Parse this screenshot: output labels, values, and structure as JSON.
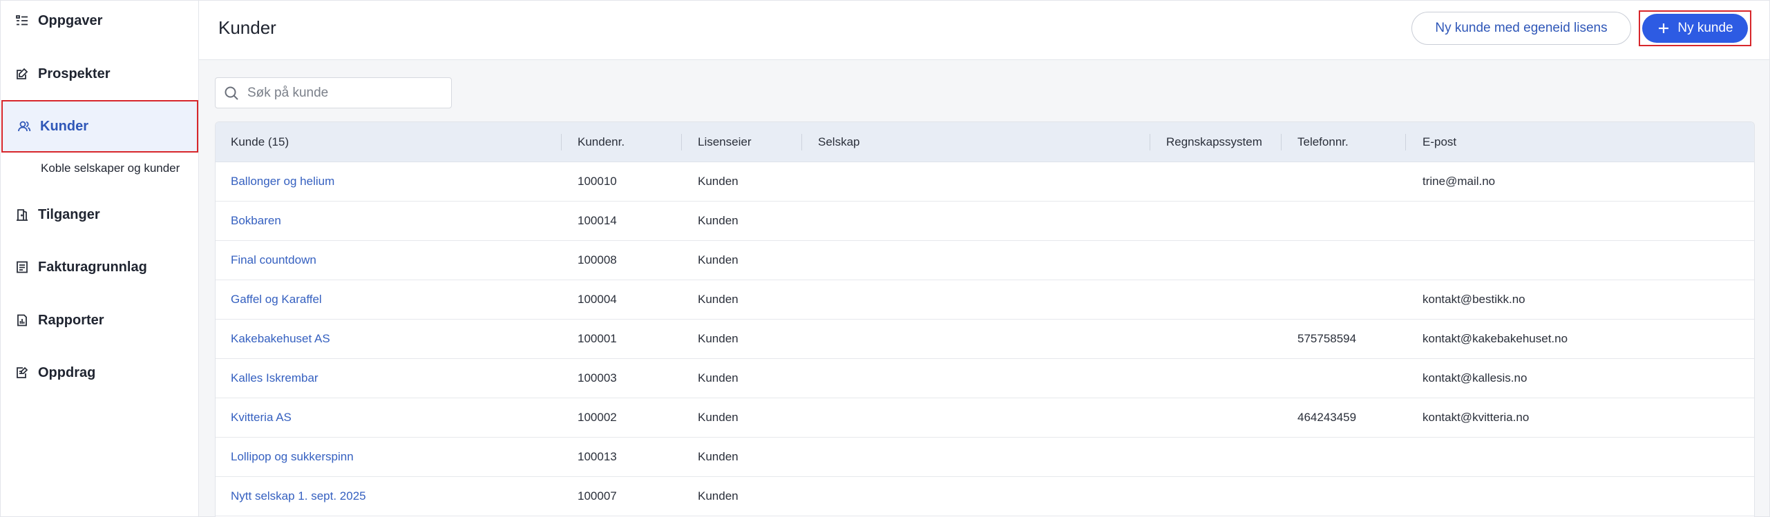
{
  "sidebar": {
    "items": [
      {
        "label": "Oppgaver",
        "icon": "task-list-icon"
      },
      {
        "label": "Prospekter",
        "icon": "edit-note-icon"
      },
      {
        "label": "Kunder",
        "icon": "users-icon"
      },
      {
        "label": "Tilganger",
        "icon": "access-door-icon"
      },
      {
        "label": "Fakturagrunnlag",
        "icon": "document-lines-icon"
      },
      {
        "label": "Rapporter",
        "icon": "report-chart-icon"
      },
      {
        "label": "Oppdrag",
        "icon": "assignment-edit-icon"
      }
    ],
    "sub_item": "Koble selskaper og kunder"
  },
  "header": {
    "title": "Kunder",
    "secondary_button": "Ny kunde med egeneid lisens",
    "primary_button": "Ny kunde"
  },
  "search": {
    "placeholder": "Søk på kunde"
  },
  "table": {
    "columns": [
      "Kunde (15)",
      "Kundenr.",
      "Lisenseier",
      "Selskap",
      "Regnskapssystem",
      "Telefonnr.",
      "E-post"
    ],
    "rows": [
      [
        "Ballonger og helium",
        "100010",
        "Kunden",
        "",
        "",
        "",
        "trine@mail.no"
      ],
      [
        "Bokbaren",
        "100014",
        "Kunden",
        "",
        "",
        "",
        ""
      ],
      [
        "Final countdown",
        "100008",
        "Kunden",
        "",
        "",
        "",
        ""
      ],
      [
        "Gaffel og Karaffel",
        "100004",
        "Kunden",
        "",
        "",
        "",
        "kontakt@bestikk.no"
      ],
      [
        "Kakebakehuset AS",
        "100001",
        "Kunden",
        "",
        "",
        "575758594",
        "kontakt@kakebakehuset.no"
      ],
      [
        "Kalles Iskrembar",
        "100003",
        "Kunden",
        "",
        "",
        "",
        "kontakt@kallesis.no"
      ],
      [
        "Kvitteria AS",
        "100002",
        "Kunden",
        "",
        "",
        "464243459",
        "kontakt@kvitteria.no"
      ],
      [
        "Lollipop og sukkerspinn",
        "100013",
        "Kunden",
        "",
        "",
        "",
        ""
      ],
      [
        "Nytt selskap 1. sept. 2025",
        "100007",
        "Kunden",
        "",
        "",
        "",
        ""
      ]
    ]
  },
  "colors": {
    "accent": "#2d5be3",
    "link": "#3560c0",
    "highlight_border": "#d7262b",
    "active_bg": "#edf2fc"
  }
}
